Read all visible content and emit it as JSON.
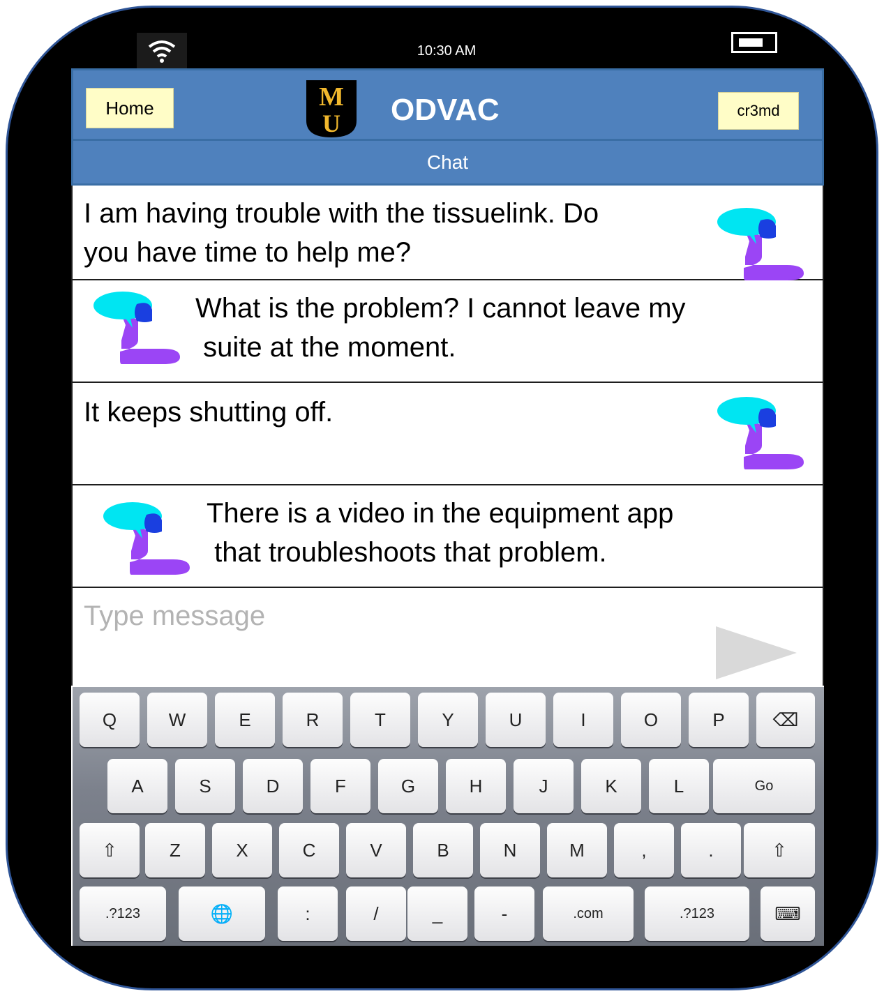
{
  "status_bar": {
    "time": "10:30 AM",
    "wifi_icon": "wifi-icon",
    "battery_icon": "battery-icon"
  },
  "header": {
    "home_label": "Home",
    "title": "ODVAC",
    "user_label": "cr3md",
    "logo_letters": [
      "M",
      "U"
    ],
    "logo_icon": "mizzou-logo"
  },
  "subheader": {
    "title": "Chat"
  },
  "messages": [
    {
      "side": "outgoing",
      "lines": [
        "I am having trouble with the tissuelink. Do",
        "you have time to help me?"
      ]
    },
    {
      "side": "incoming",
      "lines": [
        "What is the problem? I cannot leave my",
        " suite at the moment."
      ]
    },
    {
      "side": "outgoing",
      "lines": [
        "It keeps shutting off."
      ]
    },
    {
      "side": "incoming",
      "lines": [
        "There is a video in the equipment app",
        " that troubleshoots that problem."
      ]
    }
  ],
  "composer": {
    "placeholder": "Type message",
    "send_icon": "send-arrow-icon"
  },
  "keyboard": {
    "row1": [
      "Q",
      "W",
      "E",
      "R",
      "T",
      "Y",
      "U",
      "I",
      "O",
      "P",
      "⌫"
    ],
    "row2": [
      "A",
      "S",
      "D",
      "F",
      "G",
      "H",
      "J",
      "K",
      "L",
      "Go"
    ],
    "row3": [
      "⇧",
      "Z",
      "X",
      "C",
      "V",
      "B",
      "N",
      "M",
      ",",
      ".",
      "⇧"
    ],
    "row4": [
      ".?123",
      "🌐",
      ":",
      "/",
      "_",
      "-",
      ".com",
      ".?123",
      "⌨"
    ]
  },
  "colors": {
    "header_bg": "#4f81bd",
    "button_bg": "#fffdc7",
    "avatar_bubble": "#00e5f2",
    "avatar_body": "#9b45f5",
    "device_border": "#2f5597"
  }
}
